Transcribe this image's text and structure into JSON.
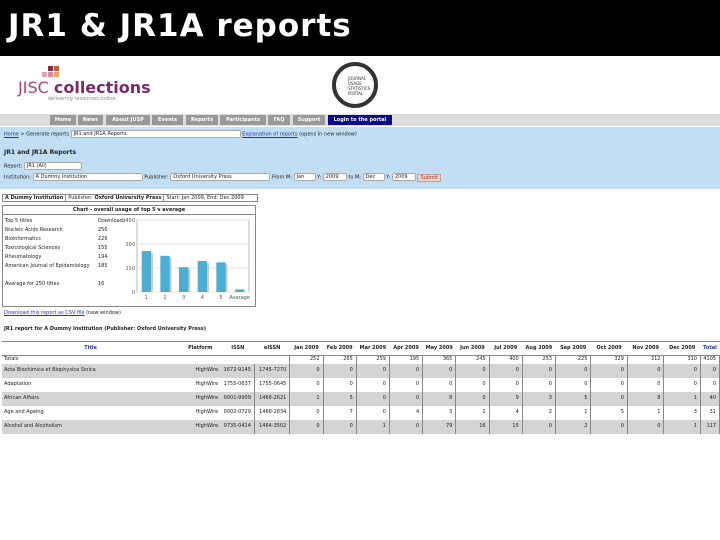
{
  "slide_title": "JR1 & JR1A reports",
  "logo": {
    "jisc": "JISC",
    "collections": "collections",
    "tagline": "delivering resources online",
    "jusp": [
      "JOURNAL",
      "USAGE",
      "STATISTICS",
      "PORTAL"
    ]
  },
  "nav": [
    "Home",
    "News",
    "About JUSP",
    "Events",
    "Reports",
    "Participants",
    "FAQ",
    "Support",
    "Login to the portal"
  ],
  "breadcrumb": {
    "home": "Home",
    "sep": " > Generate reports",
    "select": "JR1 and JR1A Reports",
    "explain_link": "Explanation of reports",
    "explain_note": "(opens in new window)"
  },
  "heading": "JR1 and JR1A Reports",
  "form": {
    "report_label": "Report:",
    "report_value": "JR1 (All)",
    "institution_label": "Institution:",
    "institution_value": "A Dummy Institution",
    "publisher_label": "Publisher:",
    "publisher_value": "Oxford University Press",
    "from_m_label": "From M:",
    "from_m": "Jan",
    "from_y_label": "Y:",
    "from_y": "2009",
    "to_m_label": "to M:",
    "to_m": "Dec",
    "to_y_label": "Y:",
    "to_y": "2009",
    "submit": "Submit"
  },
  "info": {
    "institution": "A Dummy Institution",
    "publisher_label": "Publisher:",
    "publisher": "Oxford University Press",
    "period": "Start: Jan 2009, End: Dec 2009"
  },
  "summary": {
    "title": "Chart - overall usage of top 5 v average",
    "col_title": "Top 5 titles",
    "col_downloads": "Downloads",
    "rows": [
      {
        "t": "Nucleic Acids Research",
        "v": "256"
      },
      {
        "t": "Bioinformatics",
        "v": "226"
      },
      {
        "t": "Toxicological Sciences",
        "v": "155"
      },
      {
        "t": "Rheumatology",
        "v": "194"
      },
      {
        "t": "American Journal of Epidemiology",
        "v": "185"
      }
    ],
    "average_label": "Average for 250 titles",
    "average": "16"
  },
  "chart_data": {
    "type": "bar",
    "title": "Chart - overall usage of top 5 v average",
    "categories": [
      "1",
      "2",
      "3",
      "4",
      "5",
      "Average"
    ],
    "values": [
      256,
      226,
      155,
      194,
      185,
      16
    ],
    "yticks": [
      "0",
      "150",
      "300",
      "450"
    ],
    "ylim": [
      0,
      450
    ],
    "color": "#4aaed0"
  },
  "download": {
    "link": "Download this report as CSV file",
    "note": "(new window)"
  },
  "report_title": "JR1 report for A Dummy Institution (Publisher: Oxford University Press)",
  "table": {
    "headers": [
      "Title",
      "Platform",
      "ISSN",
      "eISSN",
      "Jan 2009",
      "Feb 2009",
      "Mar 2009",
      "Apr 2009",
      "May 2009",
      "Jun 2009",
      "Jul 2009",
      "Aug 2009",
      "Sep 2009",
      "Oct 2009",
      "Nov 2009",
      "Dec 2009",
      "Total"
    ],
    "totals_label": "Totals",
    "totals": [
      "252",
      "265",
      "259",
      "195",
      "365",
      "245",
      "400",
      "253",
      "225",
      "329",
      "312",
      "310",
      "4105"
    ],
    "rows": [
      {
        "title": "Acta Biochimica et Biophysica Sinica",
        "platform": "HighWire",
        "issn": "1672-9145",
        "eissn": "1745-7270",
        "m": [
          "0",
          "0",
          "0",
          "0",
          "0",
          "0",
          "0",
          "0",
          "0",
          "0",
          "0",
          "0",
          "0"
        ]
      },
      {
        "title": "Adaptation",
        "platform": "HighWire",
        "issn": "1755-0637",
        "eissn": "1755-0645",
        "m": [
          "0",
          "0",
          "0",
          "0",
          "0",
          "0",
          "0",
          "0",
          "0",
          "0",
          "0",
          "0",
          "0"
        ]
      },
      {
        "title": "African Affairs",
        "platform": "HighWire",
        "issn": "0001-9909",
        "eissn": "1468-2621",
        "m": [
          "1",
          "5",
          "0",
          "0",
          "8",
          "0",
          "9",
          "3",
          "5",
          "0",
          "8",
          "1",
          "40"
        ]
      },
      {
        "title": "Age and Ageing",
        "platform": "HighWire",
        "issn": "0002-0729",
        "eissn": "1468-2834",
        "m": [
          "0",
          "7",
          "0",
          "4",
          "3",
          "1",
          "4",
          "2",
          "1",
          "5",
          "1",
          "3",
          "31"
        ]
      },
      {
        "title": "Alcohol and Alcoholism",
        "platform": "HighWire",
        "issn": "0735-0414",
        "eissn": "1464-3502",
        "m": [
          "0",
          "0",
          "1",
          "0",
          "79",
          "16",
          "15",
          "0",
          "2",
          "0",
          "0",
          "1",
          "117"
        ]
      }
    ]
  }
}
